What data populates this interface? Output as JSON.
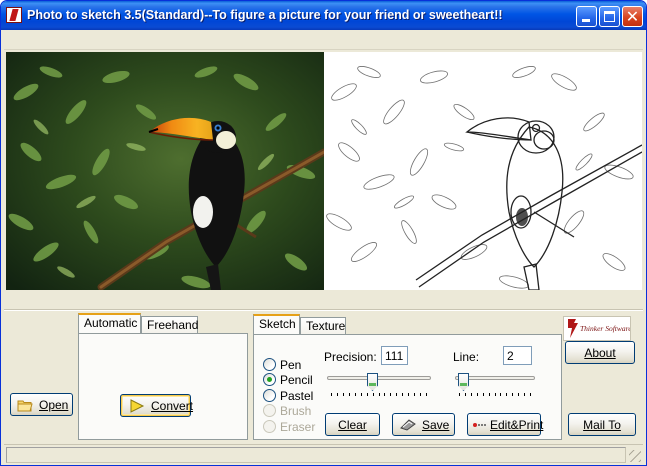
{
  "window": {
    "title": "Photo to sketch 3.5(Standard)--To figure a picture for your friend or sweetheart!!",
    "controls": {
      "minimize": "minimize",
      "maximize": "maximize",
      "close": "close"
    }
  },
  "images": {
    "original_alt": "toucan-photo",
    "sketch_alt": "toucan-sketch"
  },
  "buttons": {
    "open": "Open",
    "convert": "Convert",
    "clear": "Clear",
    "save": "Save",
    "edit_print": "Edit&Print",
    "about": "About",
    "mail_to": "Mail To"
  },
  "mode_tabs": [
    {
      "label": "Automatic",
      "active": true
    },
    {
      "label": "Freehand",
      "active": false
    }
  ],
  "style_tabs": [
    {
      "label": "Sketch",
      "active": true
    },
    {
      "label": "Texture",
      "active": false
    }
  ],
  "tools": [
    {
      "label": "Pen",
      "checked": false,
      "enabled": true
    },
    {
      "label": "Pencil",
      "checked": true,
      "enabled": true
    },
    {
      "label": "Pastel",
      "checked": false,
      "enabled": true
    },
    {
      "label": "Brush",
      "checked": false,
      "enabled": false
    },
    {
      "label": "Eraser",
      "checked": false,
      "enabled": false
    }
  ],
  "precision": {
    "label": "Precision:",
    "value": "111",
    "level": 0.43
  },
  "line": {
    "label": "Line:",
    "value": "2",
    "level": 0.05
  },
  "logo": {
    "text": "Thinker Software"
  },
  "colors": {
    "accent": "#0054e3",
    "tab_highlight": "#e6a117",
    "checked": "#21a121",
    "window_bg": "#ece9d8"
  }
}
